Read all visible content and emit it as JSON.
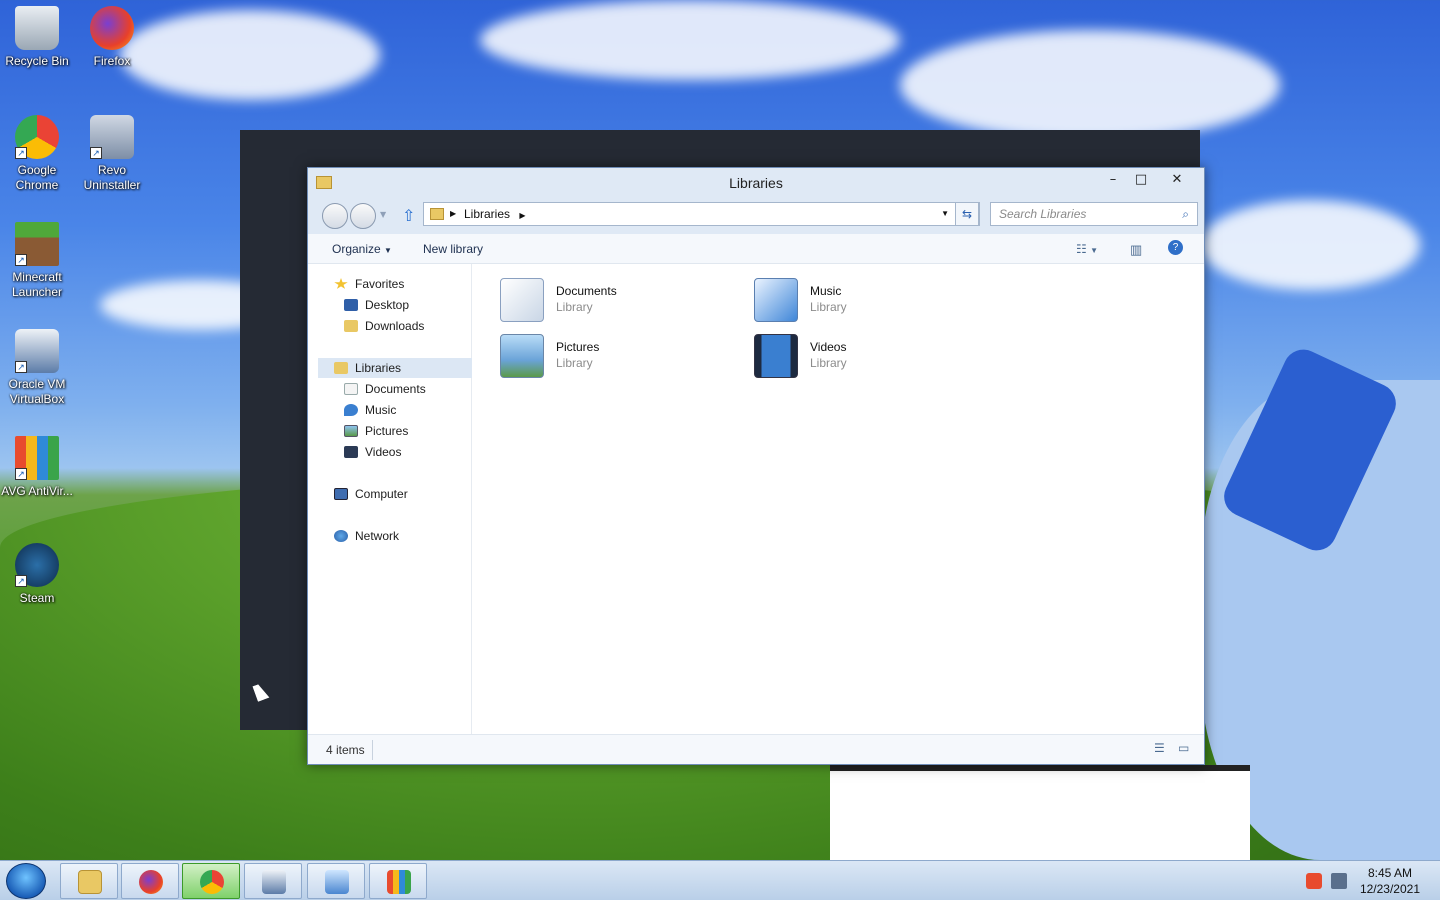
{
  "desktop": {
    "icons": [
      {
        "label": "Recycle Bin",
        "icon": "recycle-bin-icon"
      },
      {
        "label": "Firefox",
        "icon": "firefox-icon"
      },
      {
        "label": "Google Chrome",
        "icon": "chrome-icon"
      },
      {
        "label": "Revo Uninstaller",
        "icon": "revo-uninstaller-icon"
      },
      {
        "label": "Minecraft Launcher",
        "icon": "minecraft-icon"
      },
      {
        "label": "Oracle VM VirtualBox",
        "icon": "virtualbox-icon"
      },
      {
        "label": "AVG AntiVir...",
        "icon": "avg-antivirus-icon"
      },
      {
        "label": "Steam",
        "icon": "steam-icon"
      }
    ]
  },
  "explorer": {
    "title": "Libraries",
    "breadcrumb": "Libraries",
    "search_placeholder": "Search Libraries",
    "toolbar": {
      "organize": "Organize",
      "new_library": "New library"
    },
    "sidebar": {
      "favorites": "Favorites",
      "desktop": "Desktop",
      "downloads": "Downloads",
      "libraries": "Libraries",
      "documents": "Documents",
      "music": "Music",
      "pictures": "Pictures",
      "videos": "Videos",
      "computer": "Computer",
      "network": "Network"
    },
    "libraries": [
      {
        "name": "Documents",
        "kind": "Library",
        "icon": "documents-library-icon"
      },
      {
        "name": "Music",
        "kind": "Library",
        "icon": "music-library-icon"
      },
      {
        "name": "Pictures",
        "kind": "Library",
        "icon": "pictures-library-icon"
      },
      {
        "name": "Videos",
        "kind": "Library",
        "icon": "videos-library-icon"
      }
    ],
    "status": "4 items"
  },
  "taskbar": {
    "apps": [
      "file-explorer-icon",
      "firefox-icon",
      "chrome-icon",
      "virtualbox-icon",
      "control-panel-icon",
      "avg-antivirus-icon"
    ],
    "time": "8:45 AM",
    "date": "12/23/2021"
  }
}
